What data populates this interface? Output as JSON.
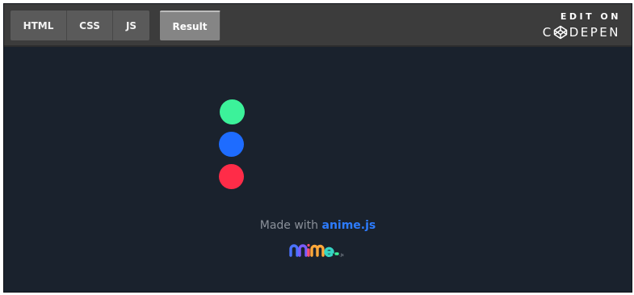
{
  "tabs": [
    {
      "label": "HTML"
    },
    {
      "label": "CSS"
    },
    {
      "label": "JS"
    }
  ],
  "active_tab": {
    "label": "Result"
  },
  "codepen": {
    "edit_on": "EDIT ON",
    "brand_first": "C",
    "brand_rest": "DEPEN",
    "logo_icon": "codepen-cube-icon"
  },
  "dots": [
    {
      "name": "green",
      "color": "#3cf29a"
    },
    {
      "name": "blue",
      "color": "#1e6cff"
    },
    {
      "name": "red",
      "color": "#ff2c48"
    }
  ],
  "footer": {
    "made_with": "Made with",
    "link": "anime.js",
    "logo_text": "anime",
    "logo_suffix": ".js",
    "logo_icon": "anime-js-logo"
  },
  "colors": {
    "background": "#1a222d",
    "topbar": "#3c3c3c",
    "tab": "#5a5a5a",
    "active_tab": "#858585",
    "link": "#2d7cff"
  }
}
